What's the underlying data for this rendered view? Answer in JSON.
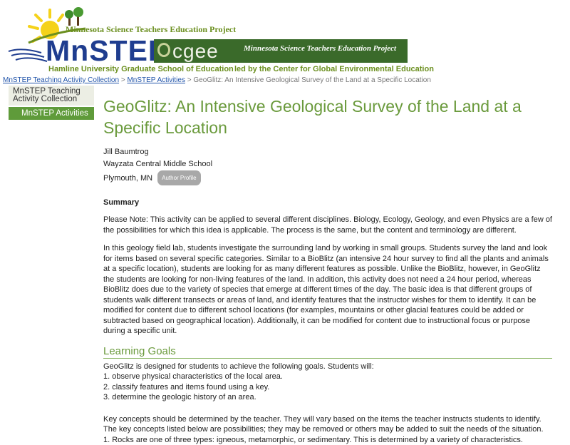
{
  "banner": {
    "project_name": "Minnesota Science Teachers Education Project",
    "logo_word": "MnSTEP",
    "university": "Hamline University Graduate School of Education",
    "cgee_word": "cgee",
    "cgee_subtitle": "Minnesota Science Teachers Education Project",
    "led_by": "led by the Center for Global Environmental Education",
    "colors": {
      "green": "#6b8f1f",
      "blue": "#1f3d8f",
      "sun": "#f5d21a",
      "cgee_bg": "#3a6a2a"
    }
  },
  "breadcrumb": {
    "link1": "MnSTEP Teaching Activity Collection",
    "sep": ">",
    "link2": "MnSTEP Activities",
    "current": "GeoGlitz: An Intensive Geological Survey of the Land at a Specific Location"
  },
  "sidebar": {
    "section": "MnSTEP Teaching Activity Collection",
    "active": "MnSTEP Activities"
  },
  "page": {
    "title": "GeoGlitz: An Intensive Geological Survey of the Land at a Specific Location",
    "author": "Jill Baumtrog",
    "school": "Wayzata Central Middle School",
    "location": "Plymouth, MN",
    "profile_badge": "Author Profile",
    "summary_heading": "Summary",
    "note_para": "Please Note: This activity can be applied to several different disciplines. Biology, Ecology, Geology, and even Physics are a few of the possibilities for which this idea is applicable. The process is the same, but the content and terminology are different.",
    "lab_para": "In this geology field lab, students investigate the surrounding land by working in small groups. Students survey the land and look for items based on several specific categories. Similar to a BioBlitz (an intensive 24 hour survey to find all the plants and animals at a specific location), students are looking for as many different features as possible. Unlike the BioBlitz, however, in GeoGlitz the students are looking for non-living features of the land. In addition, this activity does not need a 24 hour period, whereas BioBlitz does due to the variety of species that emerge at different times of the day. The basic idea is that different groups of students walk different transects or areas of land, and identify features that the instructor wishes for them to identify. It can be modified for content due to different school locations (for examples, mountains or other glacial features could be added or subtracted based on geographical location). Additionally, it can be modified for content due to instructional focus or purpose during a specific unit.",
    "goals_heading": "Learning Goals",
    "goals_intro": "GeoGlitz is designed for students to achieve the following goals. Students will:",
    "goals": [
      "1. observe physical characteristics of the local area.",
      "2. classify features and items found using a key.",
      "3. determine the geologic history of an area."
    ],
    "key_para": "Key concepts should be determined by the teacher. They will vary based on the items the teacher instructs students to identify. The key concepts listed below are possibilities; they may be removed or others may be added to suit the needs of the situation.",
    "concept1": "1. Rocks are one of three types: igneous, metamorphic, or sedimentary. This is determined by a variety of characteristics."
  }
}
